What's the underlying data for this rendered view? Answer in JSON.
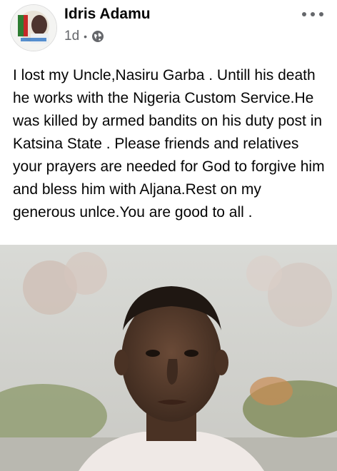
{
  "post": {
    "author": "Idris Adamu",
    "time": "1d",
    "separator": "•",
    "privacy_icon": "globe-icon",
    "more_icon": "more-options-icon",
    "text": "I lost my Uncle,Nasiru Garba . Untill his death he works with the Nigeria Custom Service.He was killed by armed bandits on his duty post in Katsina State . Please friends and relatives your prayers are needed for God to forgive him and bless him with Aljana.Rest on my generous unlce.You are good to all ."
  },
  "colors": {
    "text": "#050505",
    "meta": "#65676b",
    "background": "#ffffff"
  }
}
